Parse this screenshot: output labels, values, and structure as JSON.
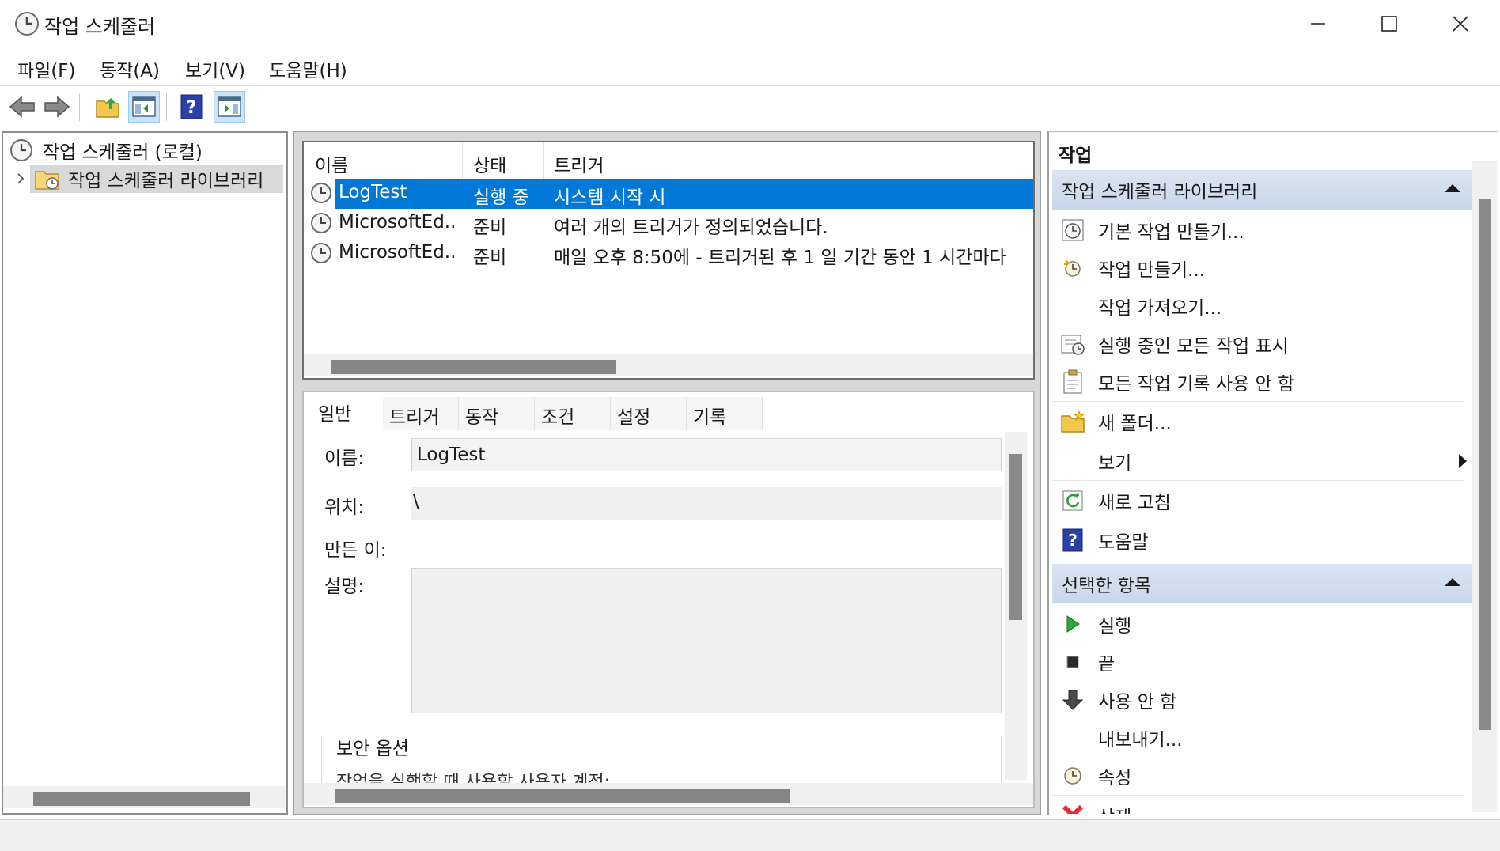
{
  "window": {
    "title": "작업 스케줄러"
  },
  "menu": [
    "파일(F)",
    "동작(A)",
    "보기(V)",
    "도움말(H)"
  ],
  "tree": {
    "root": "작업 스케줄러 (로컬)",
    "library": "작업 스케줄러 라이브러리"
  },
  "task_list": {
    "columns": [
      "이름",
      "상태",
      "트리거"
    ],
    "rows": [
      {
        "name": "LogTest",
        "status": "실행 중",
        "trigger": "시스템 시작 시"
      },
      {
        "name": "MicrosoftEd...",
        "status": "준비",
        "trigger": "여러 개의 트리거가 정의되었습니다."
      },
      {
        "name": "MicrosoftEd...",
        "status": "준비",
        "trigger": "매일 오후 8:50에 - 트리거된 후 1 일 기간 동안 1 시간마다"
      }
    ]
  },
  "detail": {
    "tabs": [
      "일반",
      "트리거",
      "동작",
      "조건",
      "설정",
      "기록"
    ],
    "labels": {
      "name": "이름:",
      "location": "위치:",
      "author": "만든 이:",
      "description": "설명:"
    },
    "values": {
      "name": "LogTest",
      "location": "\\"
    },
    "security_group": "보안 옵션",
    "security_partial": "작업을 실행할 때 사용할 사용자 계정:"
  },
  "actions": {
    "title": "작업",
    "section1": "작업 스케줄러 라이브러리",
    "items1": [
      "기본 작업 만들기...",
      "작업 만들기...",
      "작업 가져오기...",
      "실행 중인 모든 작업 표시",
      "모든 작업 기록 사용 안 함",
      "새 폴더...",
      "보기",
      "새로 고침",
      "도움말"
    ],
    "section2": "선택한 항목",
    "items2": [
      "실행",
      "끝",
      "사용 안 함",
      "내보내기...",
      "속성",
      "삭제"
    ]
  },
  "colors": {
    "selection": "#0078d7",
    "section_header": "#c7d7ea"
  }
}
